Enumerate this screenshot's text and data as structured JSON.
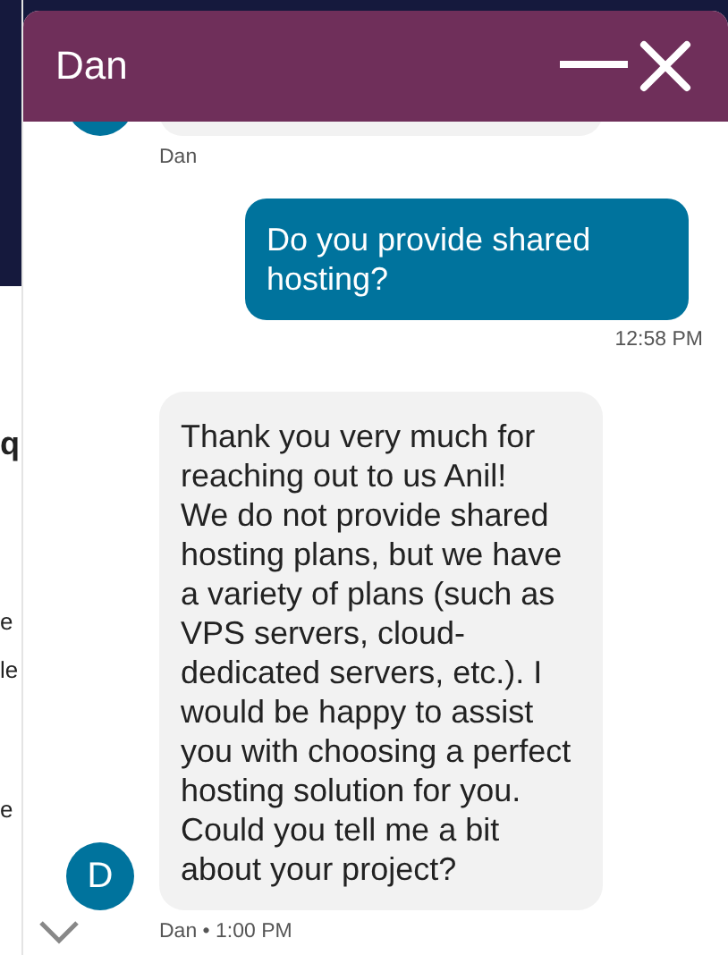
{
  "background_page": {
    "fragments": [
      "q",
      "e",
      "le",
      "e"
    ]
  },
  "chat": {
    "title": "Dan",
    "messages": [
      {
        "kind": "agent",
        "meta": "Dan"
      },
      {
        "kind": "visitor",
        "text": "Do you provide shared hosting?",
        "meta": "12:58 PM"
      },
      {
        "kind": "agent",
        "avatar": "D",
        "text": "Thank you very much for reaching out to us Anil!\nWe do not provide shared hosting plans, but we have a variety of plans (such as VPS servers, cloud-dedicated servers, etc.). I would be happy to assist you with choosing a perfect hosting solution for you.\nCould you tell me a bit about your project?",
        "meta": "Dan • 1:00 PM"
      }
    ]
  }
}
